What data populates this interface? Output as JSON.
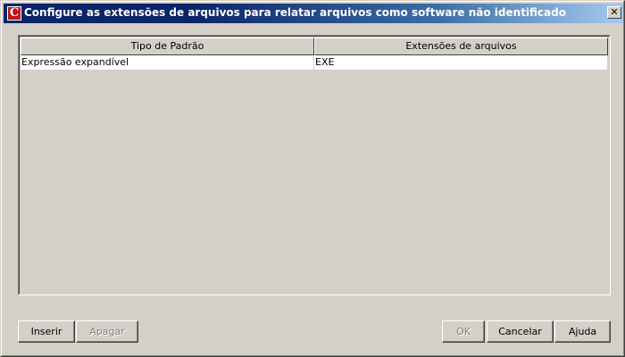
{
  "window": {
    "title": "Configure as extensões de arquivos para relatar arquivos como software não identificado",
    "icon_letter": "C",
    "close_glyph": "✕"
  },
  "table": {
    "columns": [
      "Tipo de Padrão",
      "Extensões de arquivos"
    ],
    "rows": [
      [
        "Expressão expandível",
        "EXE"
      ]
    ]
  },
  "buttons": {
    "insert": "Inserir",
    "delete": "Apagar",
    "ok": "OK",
    "cancel": "Cancelar",
    "help": "Ajuda"
  },
  "colors": {
    "titlebar": "#0a246a",
    "face": "#d4d0c8",
    "icon": "#c0141c"
  }
}
